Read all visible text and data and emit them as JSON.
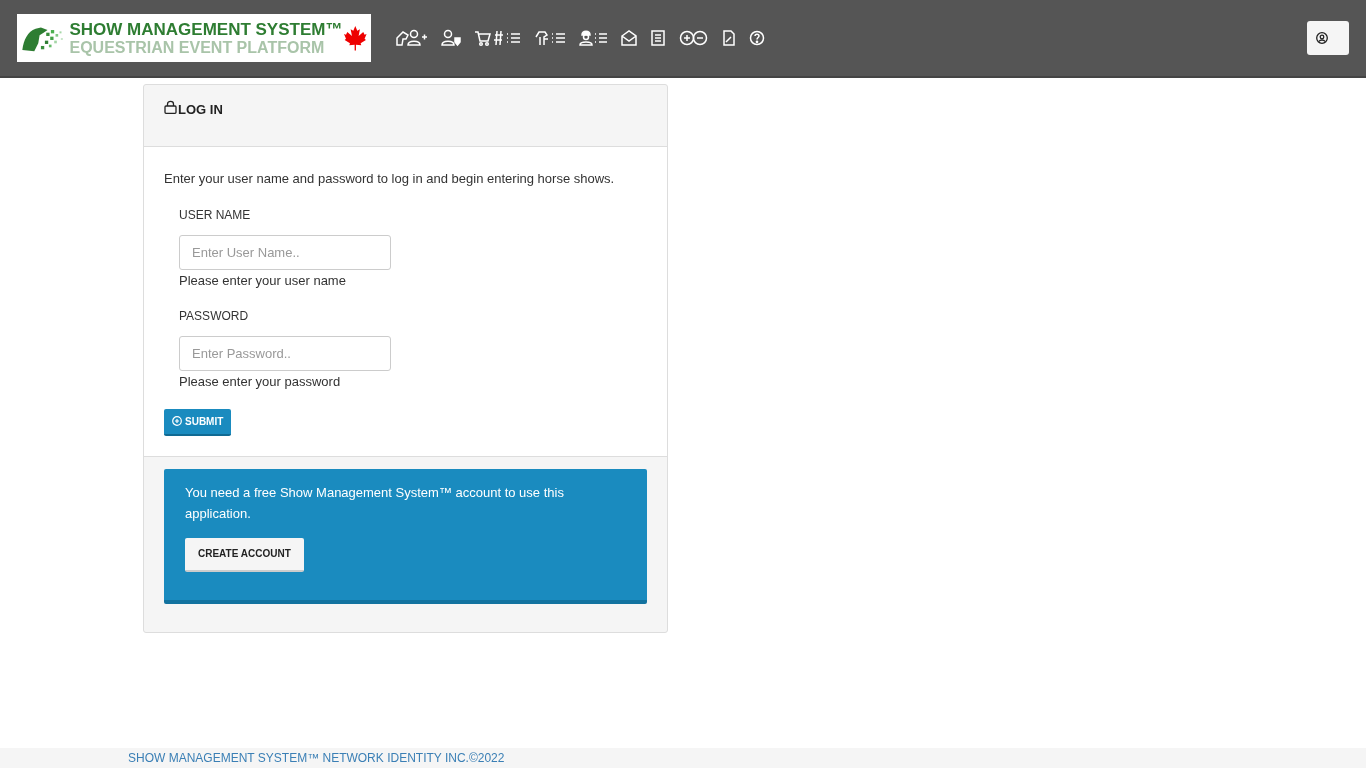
{
  "header": {
    "logo": {
      "title": "SHOW MANAGEMENT SYSTEM™",
      "subtitle": "EQUESTRIAN EVENT PLATFORM"
    }
  },
  "login": {
    "title": "LOG IN",
    "intro": "Enter your user name and password to log in and begin entering horse shows.",
    "fields": [
      {
        "label": "USER NAME",
        "placeholder": "Enter User Name..",
        "help": "Please enter your user name"
      },
      {
        "label": "PASSWORD",
        "placeholder": "Enter Password..",
        "help": "Please enter your password"
      }
    ],
    "submit": "SUBMIT",
    "notice": {
      "text": "You need a free Show Management System™ account to use this application.",
      "button": "CREATE ACCOUNT"
    }
  },
  "footer": "SHOW MANAGEMENT SYSTEM™ NETWORK IDENTITY INC.©2022"
}
